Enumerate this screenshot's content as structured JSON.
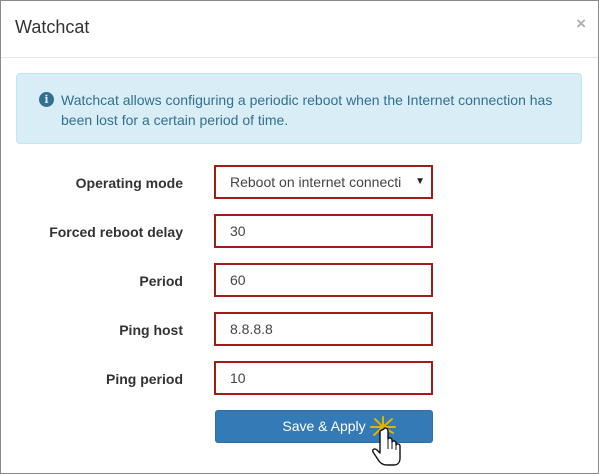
{
  "dialog": {
    "title": "Watchcat",
    "close_glyph": "×"
  },
  "info": {
    "icon": "info-circle-icon",
    "icon_glyph": "i",
    "text": "Watchcat allows configuring a periodic reboot when the Internet connection has been lost for a certain period of time."
  },
  "form": {
    "operating_mode": {
      "label": "Operating mode",
      "value": "Reboot on internet connecti"
    },
    "forced_reboot_delay": {
      "label": "Forced reboot delay",
      "value": "30"
    },
    "period": {
      "label": "Period",
      "value": "60"
    },
    "ping_host": {
      "label": "Ping host",
      "value": "8.8.8.8"
    },
    "ping_period": {
      "label": "Ping period",
      "value": "10"
    }
  },
  "save_button": {
    "label": "Save & Apply"
  },
  "colors": {
    "primary": "#337ab7",
    "alert_bg": "#d9edf7",
    "alert_text": "#31708f",
    "field_border": "#a31a1a"
  }
}
